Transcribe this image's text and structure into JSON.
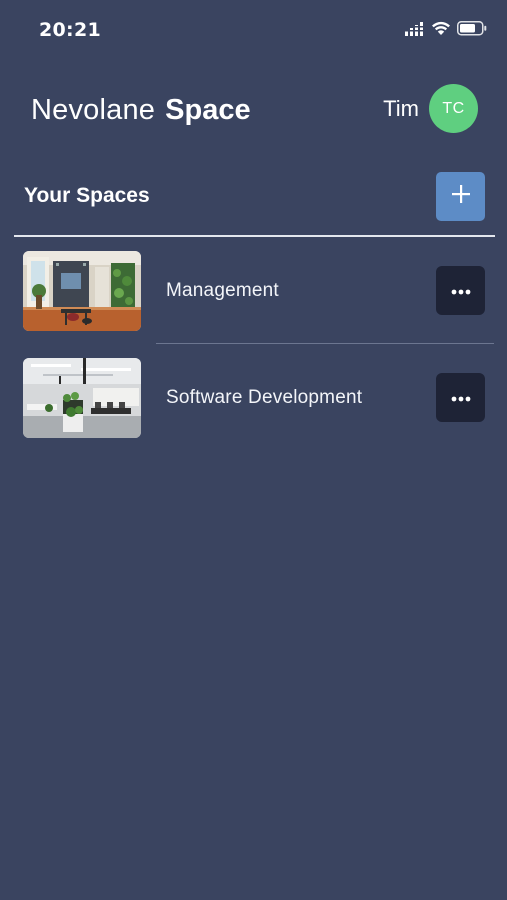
{
  "status_bar": {
    "time": "20:21",
    "icons": [
      "signal-icon",
      "wifi-icon",
      "battery-icon"
    ]
  },
  "header": {
    "brand_light": "Nevolane",
    "brand_bold": "Space",
    "user_name": "Tim",
    "avatar_initials": "TC",
    "avatar_color": "#5fcf80"
  },
  "section": {
    "title": "Your Spaces",
    "add_icon": "plus-icon",
    "add_button_color": "#5d8cc6"
  },
  "spaces": [
    {
      "label": "Management",
      "thumbnail": "office-photo-management",
      "more_icon": "ellipsis-icon"
    },
    {
      "label": "Software Development",
      "thumbnail": "office-photo-open-plan",
      "more_icon": "ellipsis-icon"
    }
  ],
  "colors": {
    "background": "#3a4460",
    "more_button": "#1e2336",
    "divider": "#e3e7ee"
  }
}
